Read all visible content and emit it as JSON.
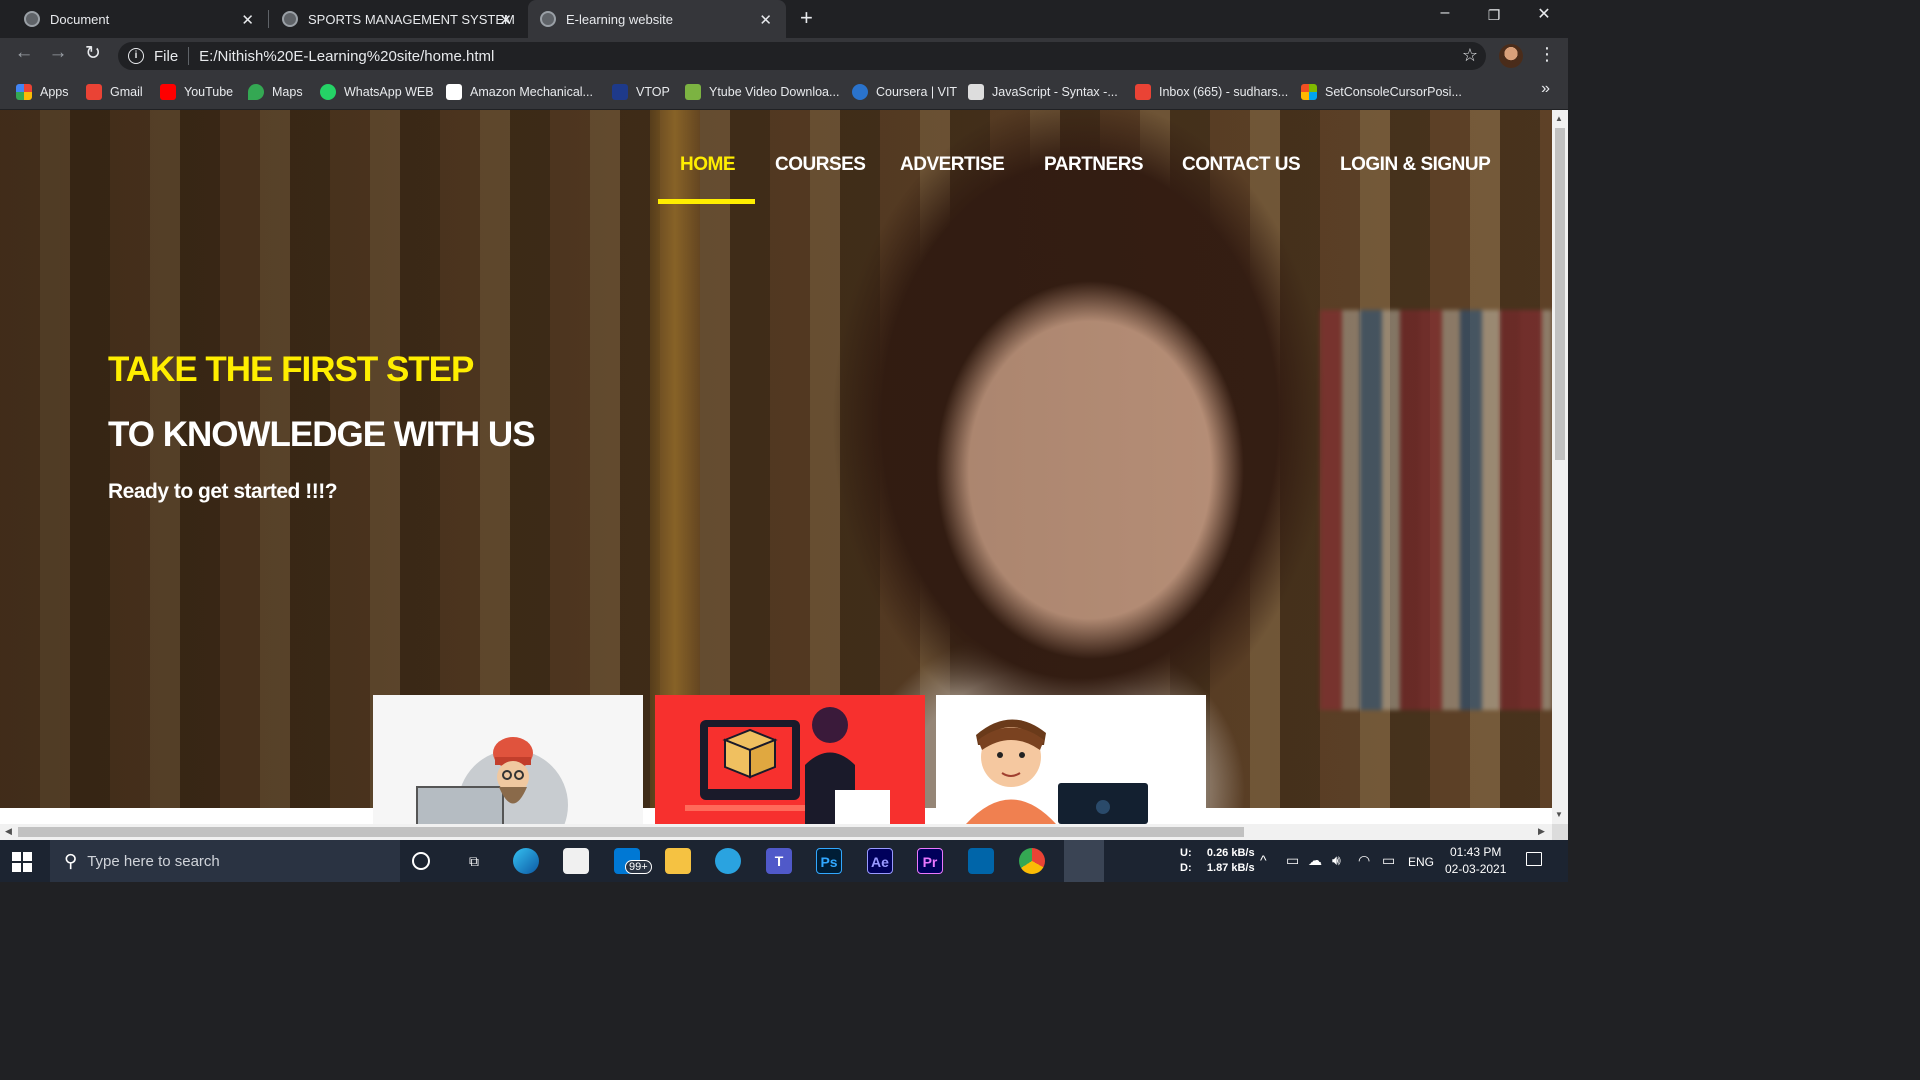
{
  "browser": {
    "tabs": [
      {
        "label": "Document",
        "active": false
      },
      {
        "label": "SPORTS MANAGEMENT SYSTEM",
        "active": false
      },
      {
        "label": "E-learning website",
        "active": true
      }
    ],
    "address": {
      "scheme_label": "File",
      "url": "E:/Nithish%20E-Learning%20site/home.html"
    },
    "bookmarks": [
      {
        "label": "Apps",
        "icon": "apps-grid-icon",
        "color": "#4285f4"
      },
      {
        "label": "Gmail",
        "icon": "gmail-icon",
        "color": "#ea4335"
      },
      {
        "label": "YouTube",
        "icon": "youtube-icon",
        "color": "#ff0000"
      },
      {
        "label": "Maps",
        "icon": "maps-icon",
        "color": "#34a853"
      },
      {
        "label": "WhatsApp WEB",
        "icon": "whatsapp-icon",
        "color": "#25d366"
      },
      {
        "label": "Amazon Mechanical...",
        "icon": "amazon-icon",
        "color": "#ffffff"
      },
      {
        "label": "VTOP",
        "icon": "vtop-icon",
        "color": "#1e3a8a"
      },
      {
        "label": "Ytube Video Downloa...",
        "icon": "download-icon",
        "color": "#7cb342"
      },
      {
        "label": "Coursera | VIT",
        "icon": "coursera-icon",
        "color": "#2a73cc"
      },
      {
        "label": "JavaScript - Syntax -...",
        "icon": "javascript-icon",
        "color": "#dddddd"
      },
      {
        "label": "Inbox (665) - sudhars...",
        "icon": "gmail-icon",
        "color": "#ea4335"
      },
      {
        "label": "SetConsoleCursorPosi...",
        "icon": "microsoft-icon",
        "color": "#f25022"
      }
    ]
  },
  "site": {
    "nav": [
      {
        "label": "HOME",
        "active": true
      },
      {
        "label": "COURSES",
        "active": false
      },
      {
        "label": "ADVERTISE",
        "active": false
      },
      {
        "label": "PARTNERS",
        "active": false
      },
      {
        "label": "CONTACT US",
        "active": false
      },
      {
        "label": "LOGIN & SIGNUP",
        "active": false
      }
    ],
    "hero": {
      "line1": "TAKE THE FIRST STEP",
      "line2": "TO KNOWLEDGE WITH US",
      "tagline": "Ready to get started !!!?"
    },
    "colors": {
      "accent": "#ffee00",
      "card_red": "#f7302e"
    }
  },
  "taskbar": {
    "search_placeholder": "Type here to search",
    "mail_badge": "99+",
    "net": {
      "up_label": "U:",
      "up": "0.26 kB/s",
      "down_label": "D:",
      "down": "1.87 kB/s"
    },
    "language": "ENG",
    "time": "01:43 PM",
    "date": "02-03-2021",
    "apps": [
      "edge-icon",
      "store-icon",
      "mail-icon",
      "explorer-icon",
      "telegram-icon",
      "teams-icon",
      "photoshop-icon",
      "aftereffects-icon",
      "premiere-icon",
      "vscode-icon",
      "chrome-icon",
      "chrome-active-icon"
    ]
  }
}
